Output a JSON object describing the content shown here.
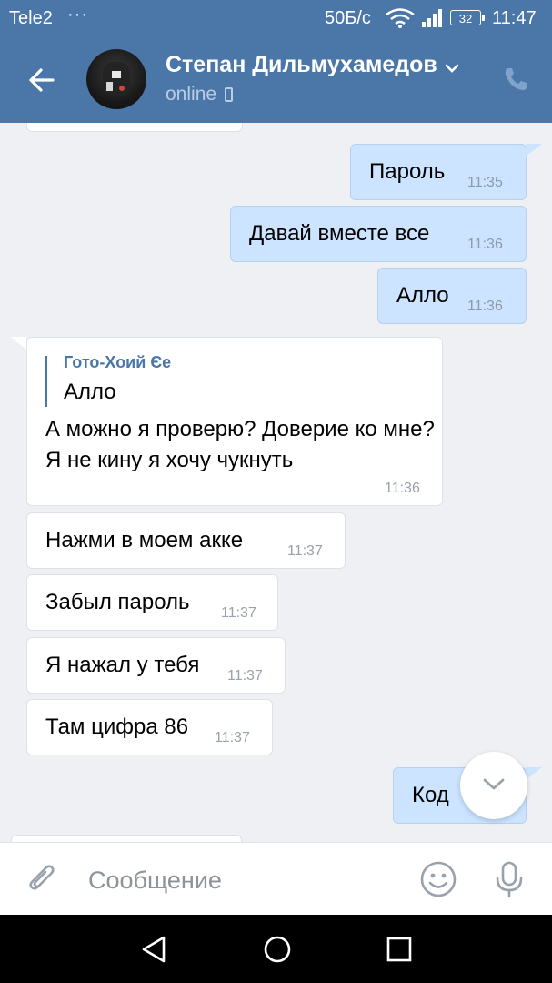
{
  "status_bar": {
    "carrier": "Tele2",
    "dots": "···",
    "speed": "50Б/с",
    "battery": "32",
    "time": "11:47"
  },
  "header": {
    "contact_name": "Степан Дильмухамедов",
    "status": "online",
    "icons": [
      "back-arrow-icon",
      "chevron-down-icon",
      "mobile-phone-icon",
      "call-icon"
    ]
  },
  "messages": [
    {
      "dir": "out",
      "text": "Пароль",
      "time": "11:35"
    },
    {
      "dir": "out",
      "text": "Давай вместе все",
      "time": "11:36"
    },
    {
      "dir": "out",
      "text": "Алло",
      "time": "11:36"
    },
    {
      "dir": "in",
      "quote_author": "Гото-Хоий Єе",
      "quote_text": "Алло",
      "text": "А можно я проверю? Доверие ко мне? Я не кину я хочу чукнуть",
      "time": "11:36"
    },
    {
      "dir": "in",
      "text": "Нажми в моем акке",
      "time": "11:37"
    },
    {
      "dir": "in",
      "text": "Забыл пароль",
      "time": "11:37"
    },
    {
      "dir": "in",
      "text": "Я нажал у тебя",
      "time": "11:37"
    },
    {
      "dir": "in",
      "text": "Там цифра 86",
      "time": "11:37"
    },
    {
      "dir": "out",
      "text": "Код",
      "time": ""
    }
  ],
  "input": {
    "placeholder": "Сообщение",
    "icons": [
      "paperclip-icon",
      "smile-icon",
      "microphone-icon"
    ]
  },
  "colors": {
    "header": "#4a76a8",
    "outgoing_bubble": "#cce4ff",
    "incoming_bubble": "#ffffff",
    "chat_background": "#eef0f3"
  }
}
